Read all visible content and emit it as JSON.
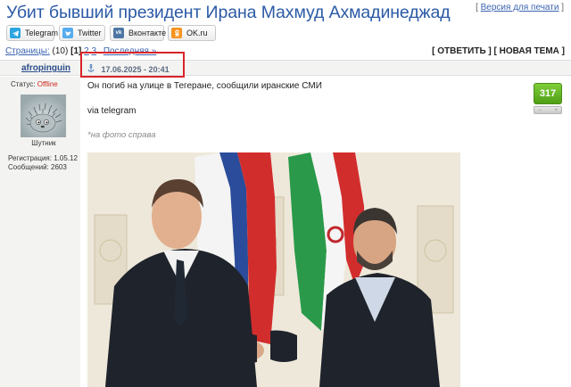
{
  "topic": {
    "title": "Убит бывший президент Ирана Махмуд Ахмадинеджад",
    "print_link": "Версия для печати"
  },
  "share": [
    {
      "label": "Telegram",
      "icon": "telegram-icon",
      "color": "#2ca5e0"
    },
    {
      "label": "Twitter",
      "icon": "twitter-icon",
      "color": "#55acee"
    },
    {
      "label": "Вконтакте",
      "icon": "vk-icon",
      "color": "#4c75a3"
    },
    {
      "label": "OK.ru",
      "icon": "ok-icon",
      "color": "#f7931e"
    }
  ],
  "pager": {
    "label": "Страницы:",
    "count": "(10)",
    "current": "1",
    "pages": [
      "2",
      "3"
    ],
    "last": "Последняя »"
  },
  "actions": {
    "reply": "ОТВЕТИТЬ",
    "new_topic": "НОВАЯ ТЕМА"
  },
  "post": {
    "author": "afropinguin",
    "date": "17.06.2025 - 20:41",
    "status_label": "Статус:",
    "status_value": "Offline",
    "rank": "Шутник",
    "reg_label": "Регистрация:",
    "reg_date": "1.05.12",
    "posts_label": "Сообщений:",
    "posts_count": "2603",
    "rating": "317",
    "rating_minus": "−",
    "rating_plus": "+",
    "text": "Он погиб на улице в Тегеране, сообщили иранские СМИ",
    "via": "via telegram",
    "photo_note": "*на фото справа"
  },
  "colors": {
    "title": "#2b5aa6",
    "highlight": "#d9232a",
    "offline": "#d0281f",
    "rating": "#5aaa1e"
  }
}
